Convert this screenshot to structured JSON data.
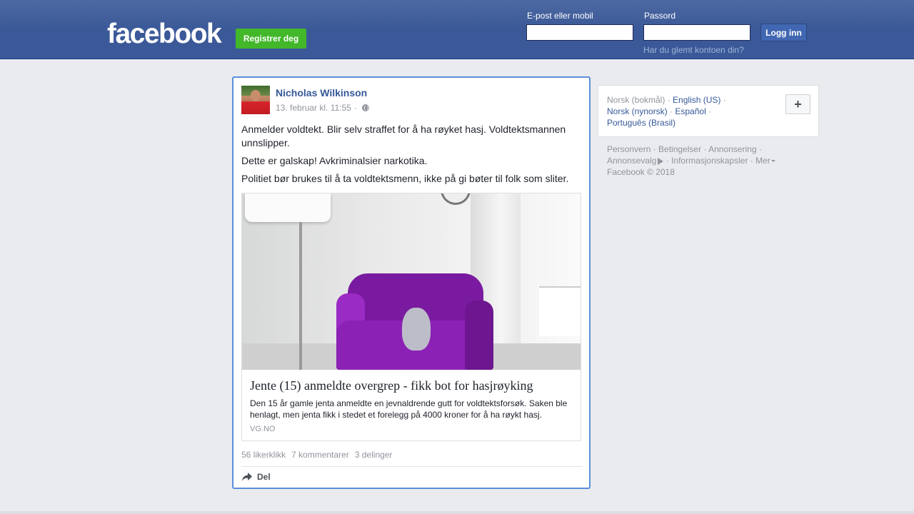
{
  "header": {
    "logo_text": "facebook",
    "register_label": "Registrer deg",
    "email_label": "E-post eller mobil",
    "email_value": "",
    "password_label": "Passord",
    "password_value": "",
    "login_label": "Logg inn",
    "forgot_label": "Har du glemt kontoen din?"
  },
  "post": {
    "author": "Nicholas Wilkinson",
    "timestamp": "13. februar kl. 11:55",
    "separator": "·",
    "audience_icon": "globe-icon",
    "paragraphs": [
      "Anmelder voldtekt. Blir selv straffet for å ha røyket hasj. Voldtektsmannen unnslipper.",
      "Dette er galskap! Avkriminalsier narkotika.",
      "Politiet bør brukes til å ta voldtektsmenn, ikke på gi bøter til folk som sliter."
    ],
    "link": {
      "title": "Jente (15) anmeldte overgrep - fikk bot for hasjrøyking",
      "description": "Den 15 år gamle jenta anmeldte en jevnaldrende gutt for voldtektsforsøk. Saken ble henlagt, men jenta fikk i stedet et forelegg på 4000 kroner for å ha røykt hasj.",
      "domain": "VG.NO"
    },
    "stats": {
      "likes": "56 likerklikk",
      "comments": "7 kommentarer",
      "shares": "3 delinger"
    },
    "share_label": "Del"
  },
  "languages": {
    "current": "Norsk (bokmål)",
    "items": [
      "English (US)",
      "Norsk (nynorsk)",
      "Español",
      "Português (Brasil)"
    ],
    "separator": "·"
  },
  "footer": {
    "links": [
      "Personvern",
      "Betingelser",
      "Annonsering",
      "Annonsevalg",
      "Informasjonskapsler",
      "Mer"
    ],
    "copyright": "Facebook © 2018"
  },
  "colors": {
    "brand": "#3b5998",
    "register_green": "#42b72a",
    "link_blue": "#365899",
    "focus_border": "#5b8fdb"
  }
}
